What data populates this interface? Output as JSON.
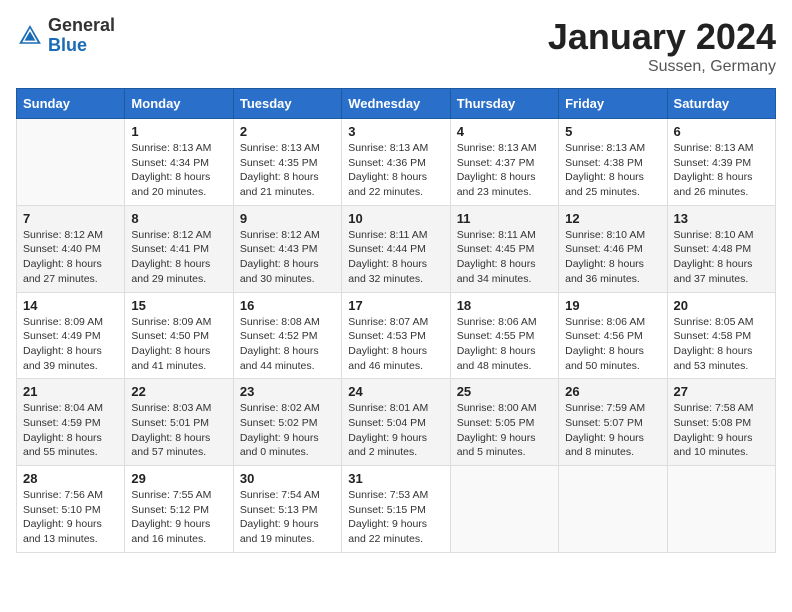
{
  "logo": {
    "general": "General",
    "blue": "Blue"
  },
  "title": {
    "month": "January 2024",
    "location": "Sussen, Germany"
  },
  "headers": [
    "Sunday",
    "Monday",
    "Tuesday",
    "Wednesday",
    "Thursday",
    "Friday",
    "Saturday"
  ],
  "weeks": [
    [
      {
        "day": "",
        "info": ""
      },
      {
        "day": "1",
        "info": "Sunrise: 8:13 AM\nSunset: 4:34 PM\nDaylight: 8 hours\nand 20 minutes."
      },
      {
        "day": "2",
        "info": "Sunrise: 8:13 AM\nSunset: 4:35 PM\nDaylight: 8 hours\nand 21 minutes."
      },
      {
        "day": "3",
        "info": "Sunrise: 8:13 AM\nSunset: 4:36 PM\nDaylight: 8 hours\nand 22 minutes."
      },
      {
        "day": "4",
        "info": "Sunrise: 8:13 AM\nSunset: 4:37 PM\nDaylight: 8 hours\nand 23 minutes."
      },
      {
        "day": "5",
        "info": "Sunrise: 8:13 AM\nSunset: 4:38 PM\nDaylight: 8 hours\nand 25 minutes."
      },
      {
        "day": "6",
        "info": "Sunrise: 8:13 AM\nSunset: 4:39 PM\nDaylight: 8 hours\nand 26 minutes."
      }
    ],
    [
      {
        "day": "7",
        "info": "Sunrise: 8:12 AM\nSunset: 4:40 PM\nDaylight: 8 hours\nand 27 minutes."
      },
      {
        "day": "8",
        "info": "Sunrise: 8:12 AM\nSunset: 4:41 PM\nDaylight: 8 hours\nand 29 minutes."
      },
      {
        "day": "9",
        "info": "Sunrise: 8:12 AM\nSunset: 4:43 PM\nDaylight: 8 hours\nand 30 minutes."
      },
      {
        "day": "10",
        "info": "Sunrise: 8:11 AM\nSunset: 4:44 PM\nDaylight: 8 hours\nand 32 minutes."
      },
      {
        "day": "11",
        "info": "Sunrise: 8:11 AM\nSunset: 4:45 PM\nDaylight: 8 hours\nand 34 minutes."
      },
      {
        "day": "12",
        "info": "Sunrise: 8:10 AM\nSunset: 4:46 PM\nDaylight: 8 hours\nand 36 minutes."
      },
      {
        "day": "13",
        "info": "Sunrise: 8:10 AM\nSunset: 4:48 PM\nDaylight: 8 hours\nand 37 minutes."
      }
    ],
    [
      {
        "day": "14",
        "info": "Sunrise: 8:09 AM\nSunset: 4:49 PM\nDaylight: 8 hours\nand 39 minutes."
      },
      {
        "day": "15",
        "info": "Sunrise: 8:09 AM\nSunset: 4:50 PM\nDaylight: 8 hours\nand 41 minutes."
      },
      {
        "day": "16",
        "info": "Sunrise: 8:08 AM\nSunset: 4:52 PM\nDaylight: 8 hours\nand 44 minutes."
      },
      {
        "day": "17",
        "info": "Sunrise: 8:07 AM\nSunset: 4:53 PM\nDaylight: 8 hours\nand 46 minutes."
      },
      {
        "day": "18",
        "info": "Sunrise: 8:06 AM\nSunset: 4:55 PM\nDaylight: 8 hours\nand 48 minutes."
      },
      {
        "day": "19",
        "info": "Sunrise: 8:06 AM\nSunset: 4:56 PM\nDaylight: 8 hours\nand 50 minutes."
      },
      {
        "day": "20",
        "info": "Sunrise: 8:05 AM\nSunset: 4:58 PM\nDaylight: 8 hours\nand 53 minutes."
      }
    ],
    [
      {
        "day": "21",
        "info": "Sunrise: 8:04 AM\nSunset: 4:59 PM\nDaylight: 8 hours\nand 55 minutes."
      },
      {
        "day": "22",
        "info": "Sunrise: 8:03 AM\nSunset: 5:01 PM\nDaylight: 8 hours\nand 57 minutes."
      },
      {
        "day": "23",
        "info": "Sunrise: 8:02 AM\nSunset: 5:02 PM\nDaylight: 9 hours\nand 0 minutes."
      },
      {
        "day": "24",
        "info": "Sunrise: 8:01 AM\nSunset: 5:04 PM\nDaylight: 9 hours\nand 2 minutes."
      },
      {
        "day": "25",
        "info": "Sunrise: 8:00 AM\nSunset: 5:05 PM\nDaylight: 9 hours\nand 5 minutes."
      },
      {
        "day": "26",
        "info": "Sunrise: 7:59 AM\nSunset: 5:07 PM\nDaylight: 9 hours\nand 8 minutes."
      },
      {
        "day": "27",
        "info": "Sunrise: 7:58 AM\nSunset: 5:08 PM\nDaylight: 9 hours\nand 10 minutes."
      }
    ],
    [
      {
        "day": "28",
        "info": "Sunrise: 7:56 AM\nSunset: 5:10 PM\nDaylight: 9 hours\nand 13 minutes."
      },
      {
        "day": "29",
        "info": "Sunrise: 7:55 AM\nSunset: 5:12 PM\nDaylight: 9 hours\nand 16 minutes."
      },
      {
        "day": "30",
        "info": "Sunrise: 7:54 AM\nSunset: 5:13 PM\nDaylight: 9 hours\nand 19 minutes."
      },
      {
        "day": "31",
        "info": "Sunrise: 7:53 AM\nSunset: 5:15 PM\nDaylight: 9 hours\nand 22 minutes."
      },
      {
        "day": "",
        "info": ""
      },
      {
        "day": "",
        "info": ""
      },
      {
        "day": "",
        "info": ""
      }
    ]
  ]
}
